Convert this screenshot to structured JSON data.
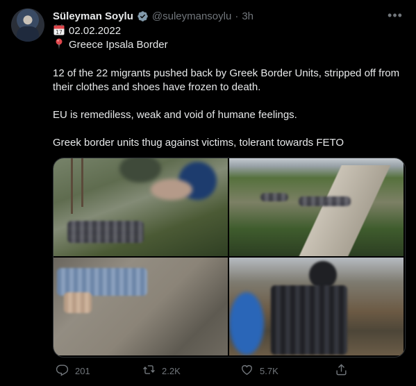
{
  "tweet": {
    "author_name": "Süleyman Soylu",
    "handle": "@suleymansoylu",
    "separator": "·",
    "time": "3h",
    "date_line": "02.02.2022",
    "location_line": "Greece Ipsala Border",
    "paragraphs": [
      "12 of the 22 migrants pushed back by Greek Border Units, stripped off from their clothes and shoes have frozen to death.",
      "EU is remediless, weak and void of humane feelings.",
      "Greek border units thug against victims, tolerant towards FETO"
    ],
    "icons": {
      "date": "calendar-icon",
      "location": "pin-icon",
      "verified": "verified-badge-icon",
      "more": "more-icon"
    },
    "colors": {
      "background": "#000000",
      "text": "#e7e9ea",
      "muted": "#71767b",
      "border": "#2f3336",
      "verified_badge": "#829aab"
    }
  },
  "actions": {
    "reply_count": "201",
    "retweet_count": "2.2K",
    "like_count": "5.7K",
    "icons": [
      "reply-icon",
      "retweet-icon",
      "like-icon",
      "share-icon"
    ]
  }
}
